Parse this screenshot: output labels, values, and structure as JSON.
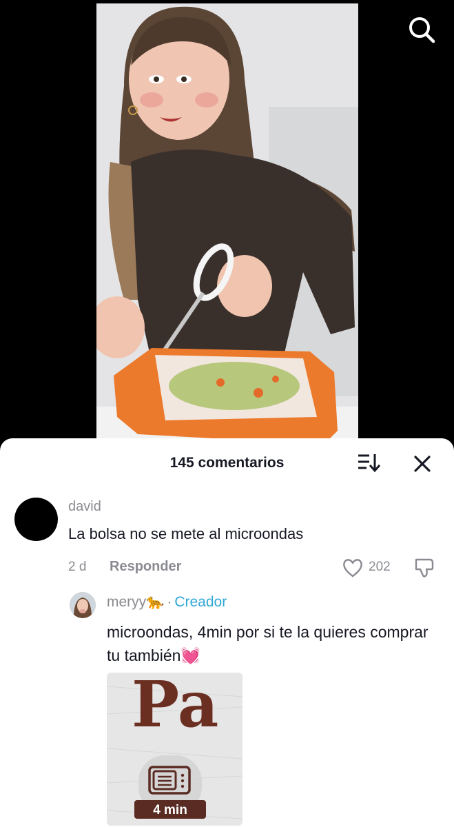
{
  "video": {
    "search_icon": "search-icon"
  },
  "comments_sheet": {
    "count_label": "145 comentarios",
    "sort_icon": "sort-icon",
    "close_icon": "close-icon"
  },
  "comment_main": {
    "username": "david",
    "text": "La bolsa no se mete al microondas",
    "date": "2 d",
    "reply_label": "Responder",
    "likes": "202"
  },
  "comment_reply": {
    "username": "meryy",
    "badge_emoji": "🐆",
    "separator": "·",
    "creator_label": "Creador",
    "text": "microondas, 4min por si te la quieres comprar tu también",
    "text_emoji": "💓",
    "attachment": {
      "brand_text": "Pa",
      "icon": "microwave-icon",
      "time_label": "4 min"
    }
  },
  "colors": {
    "creator": "#2fa7d6",
    "muted": "#8a8b91",
    "text": "#161823"
  }
}
